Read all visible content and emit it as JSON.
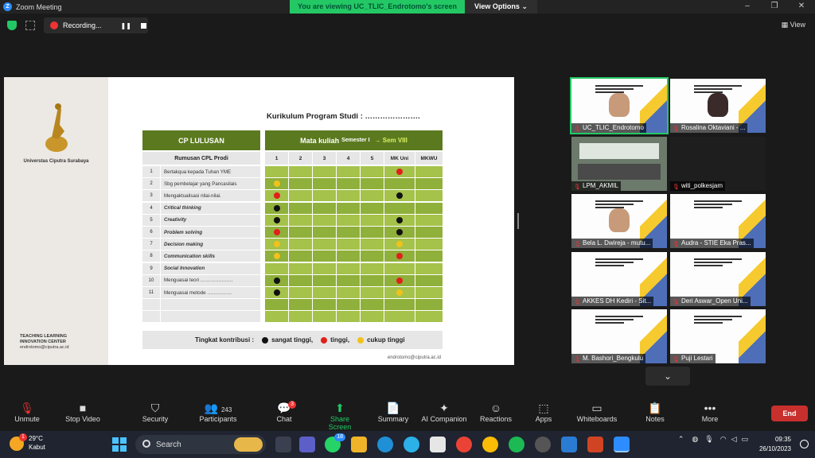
{
  "window": {
    "title": "Zoom Meeting",
    "viewing_banner": "You are viewing UC_TLIC_Endrotomo's screen",
    "view_options": "View Options ⌄",
    "view_label": "View",
    "recording": "Recording..."
  },
  "slide": {
    "university": "Universtas Ciputra Surabaya",
    "center_line1": "TEACHING LEARNING",
    "center_line2": "INNOVATION CENTER",
    "email_left": "endrotomo@ciputra.ac.id",
    "email_right": "endrotomo@ciputra.ac.id",
    "title": "Kurikulum Program Studi : ………………….",
    "cp_header": "CP LULUSAN",
    "mk_header": "Mata kuliah",
    "mk_sub": "Semester I",
    "mk_sem": "→ Sem VIII",
    "rumusan": "Rumusan CPL Prodi",
    "columns": [
      "1",
      "2",
      "3",
      "4",
      "5",
      "MK Uni",
      "MKWU"
    ],
    "rows": [
      {
        "n": "1",
        "label": "Bertakqua kepada Tuhan YME",
        "italic": false,
        "dots": {
          "5": "red"
        }
      },
      {
        "n": "2",
        "label": "Sbg pembelajar yang Pancasilais",
        "italic": false,
        "dots": {
          "0": "yellow"
        }
      },
      {
        "n": "3",
        "label": "Mengaktualisasi nilai-nilai.",
        "italic": false,
        "dots": {
          "0": "red",
          "5": "black"
        }
      },
      {
        "n": "4",
        "label": "Critical thinking",
        "italic": true,
        "dots": {
          "0": "black"
        }
      },
      {
        "n": "5",
        "label": "Creativity",
        "italic": true,
        "dots": {
          "0": "black",
          "5": "black"
        }
      },
      {
        "n": "6",
        "label": "Problem solving",
        "italic": true,
        "dots": {
          "0": "red",
          "5": "black"
        }
      },
      {
        "n": "7",
        "label": "Decision making",
        "italic": true,
        "dots": {
          "0": "yellow",
          "5": "yellow"
        }
      },
      {
        "n": "8",
        "label": "Communication skills",
        "italic": true,
        "dots": {
          "0": "yellow",
          "5": "red"
        }
      },
      {
        "n": "9",
        "label": "Social Innovation",
        "italic": true,
        "dots": {}
      },
      {
        "n": "10",
        "label": "Menguasai teori ………………..",
        "italic": false,
        "dots": {
          "0": "black",
          "5": "red"
        }
      },
      {
        "n": "11",
        "label": "Menguasai metode ……………",
        "italic": false,
        "dots": {
          "0": "black",
          "5": "yellow"
        }
      },
      {
        "n": "",
        "label": "",
        "italic": false,
        "dots": {}
      },
      {
        "n": "",
        "label": "",
        "italic": false,
        "dots": {}
      }
    ],
    "legend_label": "Tingkat kontribusi :",
    "legend_items": [
      "sangat tinggi,",
      "tinggi,",
      "cukup tinggi"
    ]
  },
  "colors": {
    "green_dark": "#5b7a1f",
    "green_light": "#a5c24a",
    "green_alt": "#8fb03a",
    "dot_black": "#111111",
    "dot_red": "#e0201c",
    "dot_yellow": "#f2c21a"
  },
  "participants": [
    {
      "name": "UC_TLIC_Endrotomo",
      "type": "slide-face",
      "active": true
    },
    {
      "name": "Rosalina Oktaviani - ...",
      "type": "slide-face"
    },
    {
      "name": "LPM_AKMIL",
      "type": "room"
    },
    {
      "name": "witi_polkesjam",
      "type": "dark"
    },
    {
      "name": "Bela L. Dwireja - mutu...",
      "type": "slide-face"
    },
    {
      "name": "Audra - STIE Eka Pras...",
      "type": "slide"
    },
    {
      "name": "AKKES DH Kediri - Sit...",
      "type": "slide"
    },
    {
      "name": "Deri Aswar_Open Uni...",
      "type": "slide"
    },
    {
      "name": "M. Bashori_Bengkulu",
      "type": "slide"
    },
    {
      "name": "Puji Lestari",
      "type": "slide"
    }
  ],
  "toolbar": {
    "unmute": "Unmute",
    "stop_video": "Stop Video",
    "security": "Security",
    "participants": "Participants",
    "participants_count": "243",
    "chat": "Chat",
    "chat_badge": "3",
    "share": "Share Screen",
    "summary": "Summary",
    "companion": "AI Companion",
    "reactions": "Reactions",
    "apps": "Apps",
    "whiteboards": "Whiteboards",
    "notes": "Notes",
    "more": "More",
    "end": "End"
  },
  "taskbar": {
    "temp": "29°C",
    "weather": "Kabut",
    "weather_badge": "1",
    "search": "Search",
    "whatsapp_badge": "18",
    "time": "09:35",
    "date": "26/10/2023"
  }
}
